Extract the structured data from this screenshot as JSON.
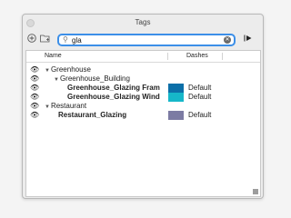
{
  "window": {
    "title": "Tags"
  },
  "toolbar": {
    "add_icon": "add-circle-icon",
    "new_folder_icon": "new-folder-icon",
    "export_icon": "arrow-right-icon",
    "search": {
      "value": "gla",
      "placeholder": ""
    }
  },
  "columns": {
    "name": "Name",
    "dashes": "Dashes"
  },
  "rows": [
    {
      "label": "Greenhouse",
      "bold": false,
      "level": 0,
      "expanded": true
    },
    {
      "label": "Greenhouse_Building",
      "bold": false,
      "level": 1,
      "expanded": true
    },
    {
      "label": "Greenhouse_Glazing Fram",
      "bold": true,
      "color": "#0c6fa8",
      "dashes": "Default"
    },
    {
      "label": "Greenhouse_Glazing Wind",
      "bold": true,
      "color": "#16b7c9",
      "dashes": "Default"
    },
    {
      "label": "Restaurant",
      "bold": false,
      "level": 0,
      "expanded": true
    },
    {
      "label": "Restaurant_Glazing",
      "bold": true,
      "color": "#7c7ba3",
      "dashes": "Default"
    }
  ]
}
